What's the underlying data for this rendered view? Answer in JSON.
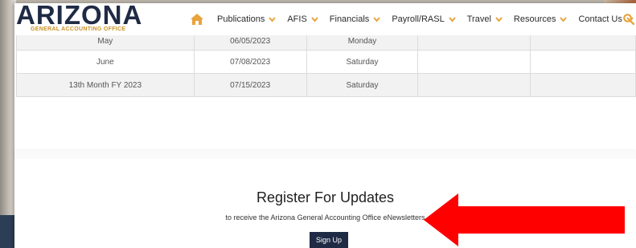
{
  "logo": {
    "name": "ARIZONA",
    "subtitle": "GENERAL ACCOUNTING OFFICE"
  },
  "nav": {
    "items": [
      {
        "label": "Publications"
      },
      {
        "label": "AFIS"
      },
      {
        "label": "Financials"
      },
      {
        "label": "Payroll/RASL"
      },
      {
        "label": "Travel"
      },
      {
        "label": "Resources"
      },
      {
        "label": "Contact Us"
      }
    ]
  },
  "table": {
    "rows": [
      {
        "period": "May",
        "date": "06/05/2023",
        "day": "Monday"
      },
      {
        "period": "June",
        "date": "07/08/2023",
        "day": "Saturday"
      },
      {
        "period": "13th Month FY 2023",
        "date": "07/15/2023",
        "day": "Saturday"
      }
    ]
  },
  "register": {
    "title": "Register For Updates",
    "subtitle": "to receive the Arizona General Accounting Office eNewsletters",
    "button_label": "Sign Up"
  },
  "colors": {
    "brand_navy": "#1f2a44",
    "accent_gold": "#e8a33d",
    "annotation_red": "#ff0000"
  },
  "icons": {
    "home": "home-icon",
    "search": "search-icon",
    "chevron": "chevron-down-icon",
    "annotation": "red-arrow-annotation"
  }
}
